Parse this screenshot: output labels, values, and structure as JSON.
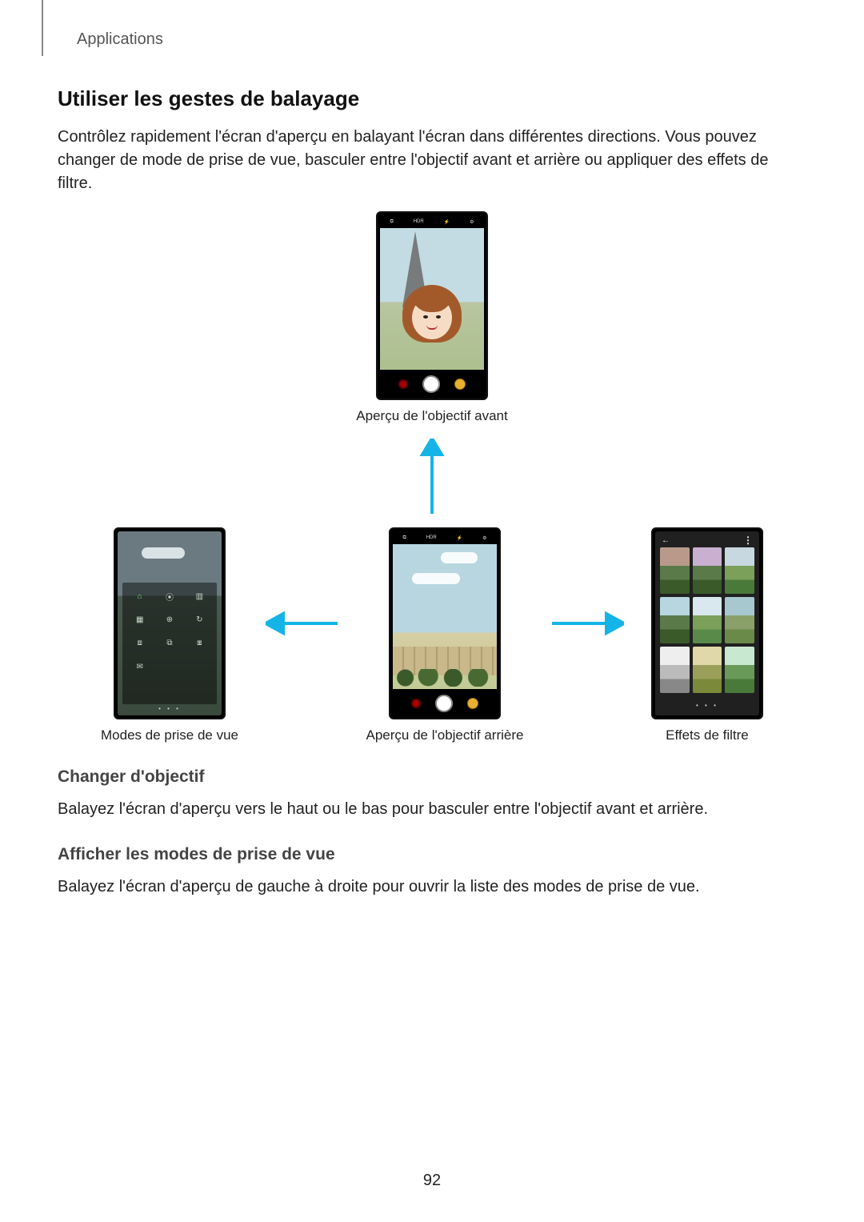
{
  "header": {
    "section_label": "Applications"
  },
  "title": "Utiliser les gestes de balayage",
  "intro": "Contrôlez rapidement l'écran d'aperçu en balayant l'écran dans différentes directions. Vous pouvez changer de mode de prise de vue, basculer entre l'objectif avant et arrière ou appliquer des effets de filtre.",
  "captions": {
    "front_preview": "Aperçu de l'objectif avant",
    "modes": "Modes de prise de vue",
    "rear_preview": "Aperçu de l'objectif arrière",
    "filters": "Effets de filtre"
  },
  "phone_top": {
    "icon1": "⧉",
    "label_hdr": "HDR",
    "icon_flash": "⚡",
    "icon_gear": "⚙"
  },
  "modes_panel": {
    "cells": [
      "⌂",
      "⦿",
      "▥",
      "▦",
      "⊕",
      "↻",
      "⧈",
      "⧉",
      "⧆",
      "✉"
    ]
  },
  "filters_panel": {
    "back": "←",
    "menu": "⋮",
    "dots": "• • •"
  },
  "sections": {
    "change_lens": {
      "heading": "Changer d'objectif",
      "body": "Balayez l'écran d'aperçu vers le haut ou le bas pour basculer entre l'objectif avant et arrière."
    },
    "show_modes": {
      "heading": "Afficher les modes de prise de vue",
      "body": "Balayez l'écran d'aperçu de gauche à droite pour ouvrir la liste des modes de prise de vue."
    }
  },
  "page_number": "92"
}
